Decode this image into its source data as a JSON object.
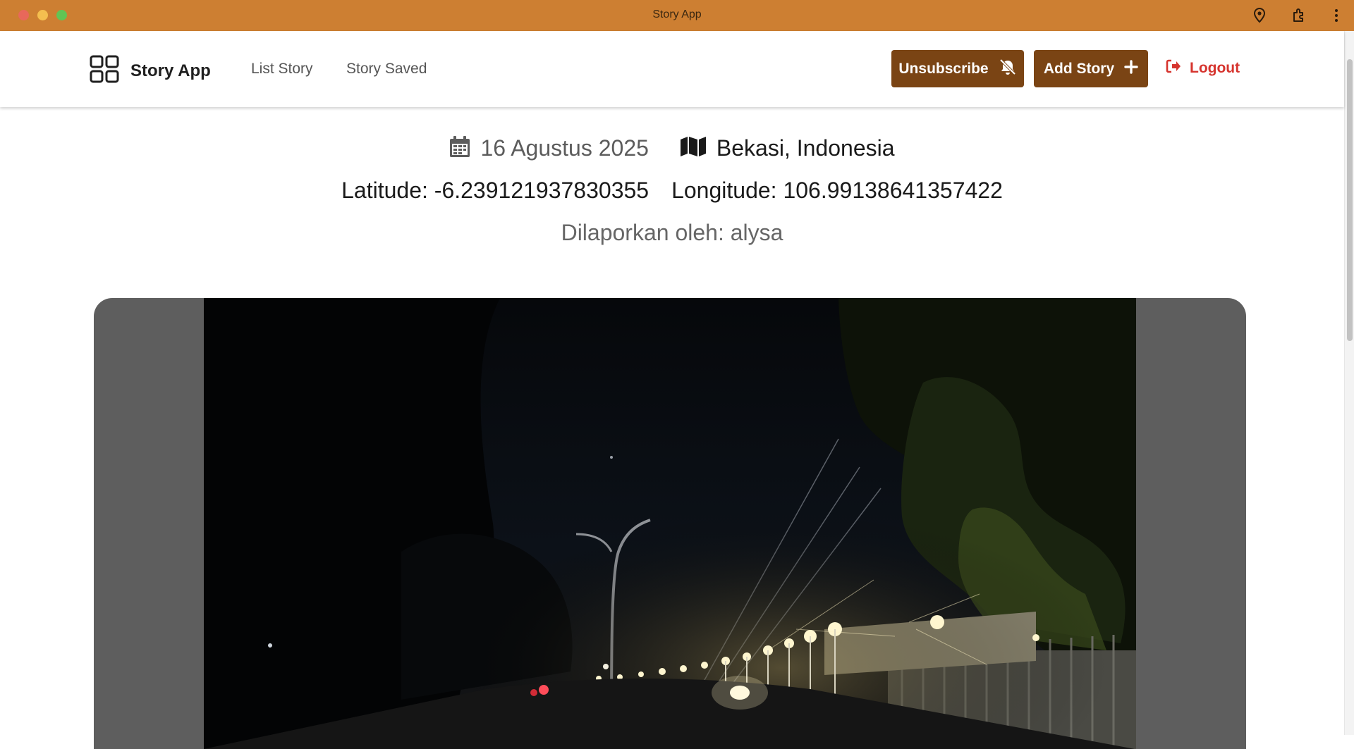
{
  "window": {
    "title": "Story App"
  },
  "navbar": {
    "brand": "Story App",
    "links": [
      "List Story",
      "Story Saved"
    ],
    "unsubscribe_label": "Unsubscribe",
    "add_story_label": "Add Story",
    "logout_label": "Logout"
  },
  "story": {
    "date": "16 Agustus 2025",
    "location": "Bekasi, Indonesia",
    "latitude": "Latitude: -6.239121937830355",
    "longitude": "Longitude: 106.99138641357422",
    "reporter": "Dilaporkan oleh: alysa"
  },
  "colors": {
    "titlebar": "#cd7f32",
    "button": "#7a4414",
    "logout": "#d6342e"
  },
  "icons": [
    "location-pin-icon",
    "extensions-icon",
    "kebab-menu-icon",
    "grid-logo-icon",
    "bell-slash-icon",
    "plus-icon",
    "logout-icon",
    "calendar-icon",
    "map-icon"
  ]
}
